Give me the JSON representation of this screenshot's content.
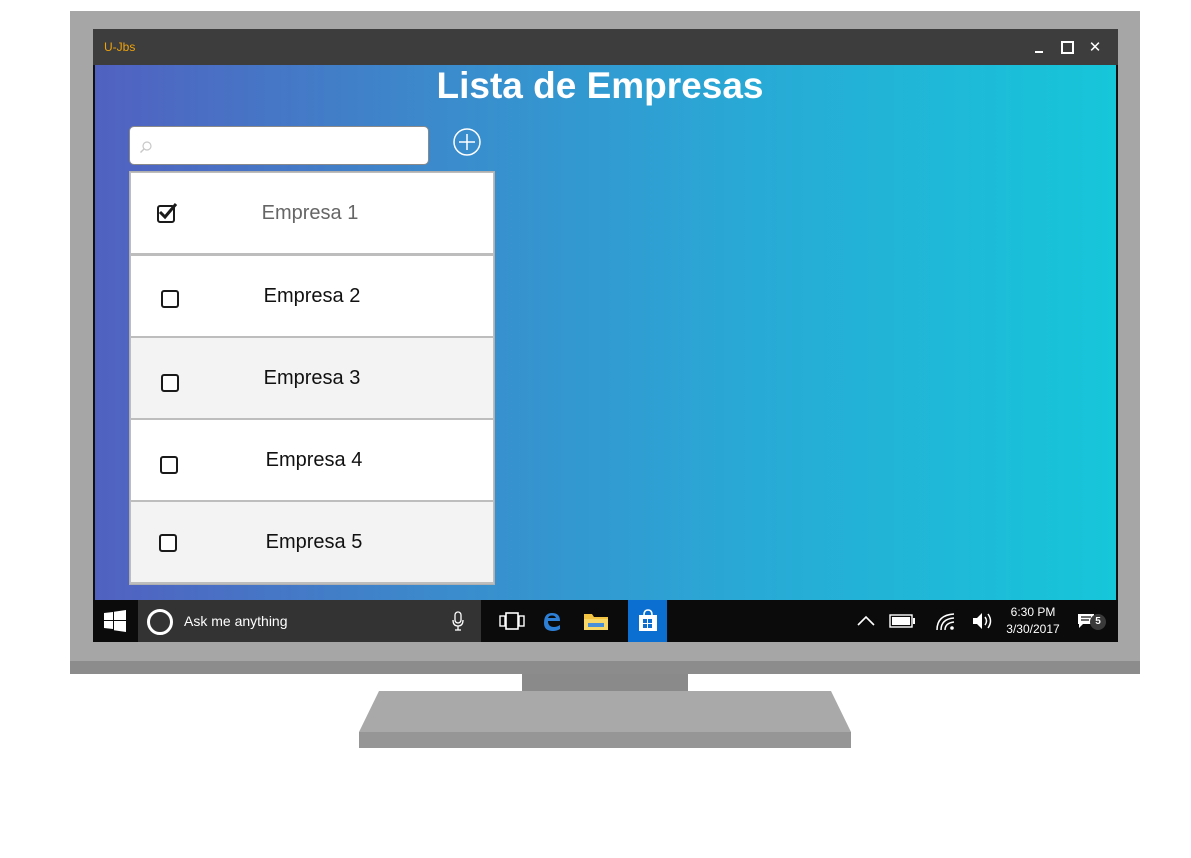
{
  "window": {
    "app_title": "U-Jbs"
  },
  "page": {
    "title": "Lista de Empresas"
  },
  "search": {
    "placeholder": ""
  },
  "companies": [
    {
      "label": "Empresa 1",
      "checked": true
    },
    {
      "label": "Empresa 2",
      "checked": false
    },
    {
      "label": "Empresa 3",
      "checked": false
    },
    {
      "label": "Empresa 4",
      "checked": false
    },
    {
      "label": "Empresa 5",
      "checked": false
    }
  ],
  "taskbar": {
    "search_placeholder": "Ask me anything",
    "time": "6:30 PM",
    "date": "3/30/2017",
    "notification_count": "5"
  },
  "colors": {
    "gradient_start": "#5161c0",
    "gradient_end": "#16c6d9",
    "app_title": "#f0a30a",
    "store_tile": "#0a6fd1"
  }
}
